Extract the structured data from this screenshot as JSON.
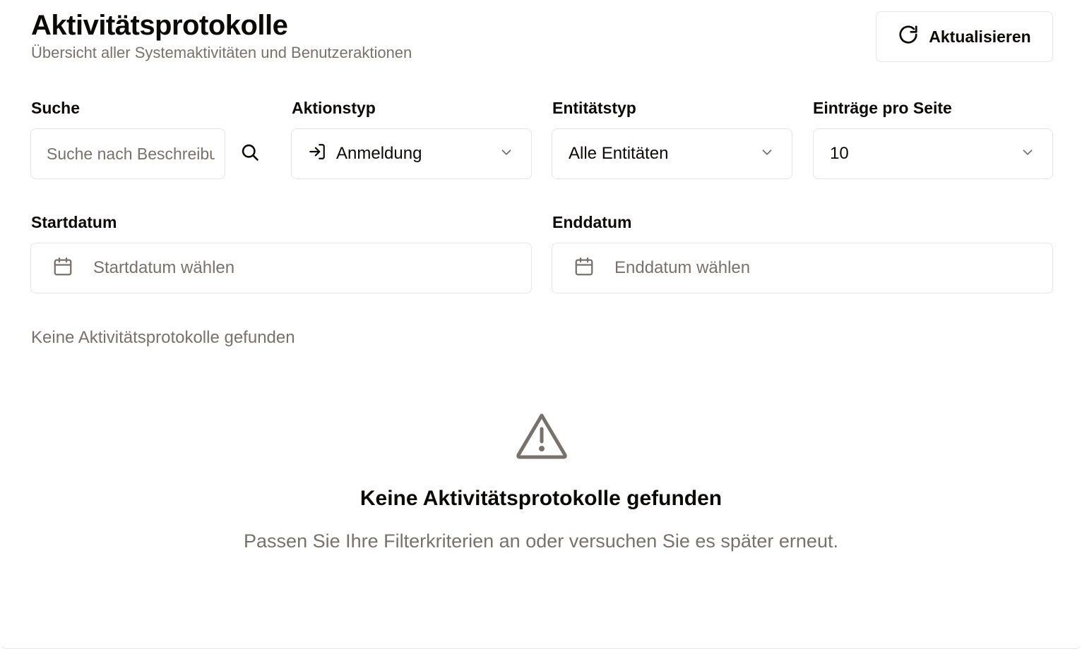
{
  "header": {
    "title": "Aktivitätsprotokolle",
    "subtitle": "Übersicht aller Systemaktivitäten und Benutzeraktionen",
    "refresh_label": "Aktualisieren"
  },
  "filters": {
    "search": {
      "label": "Suche",
      "placeholder": "Suche nach Beschreibung",
      "value": ""
    },
    "action_type": {
      "label": "Aktionstyp",
      "value": "Anmeldung",
      "icon": "login-icon"
    },
    "entity_type": {
      "label": "Entitätstyp",
      "value": "Alle Entitäten"
    },
    "page_size": {
      "label": "Einträge pro Seite",
      "value": "10"
    },
    "start_date": {
      "label": "Startdatum",
      "placeholder": "Startdatum wählen"
    },
    "end_date": {
      "label": "Enddatum",
      "placeholder": "Enddatum wählen"
    }
  },
  "results": {
    "count_text": "Keine Aktivitätsprotokolle gefunden",
    "empty_title": "Keine Aktivitätsprotokolle gefunden",
    "empty_hint": "Passen Sie Ihre Filterkriterien an oder versuchen Sie es später erneut."
  },
  "colors": {
    "text": "#0c0a09",
    "muted": "#78716c",
    "border": "#e7e5e4",
    "icon": "#78716c"
  }
}
